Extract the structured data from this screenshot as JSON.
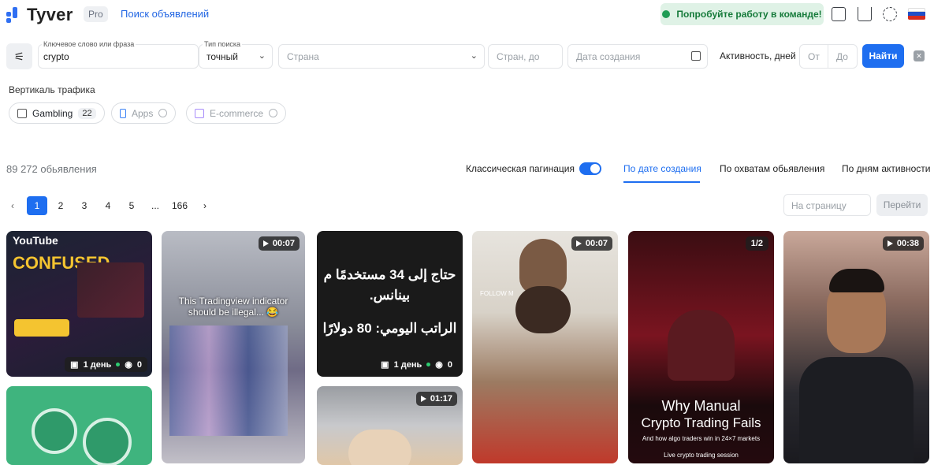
{
  "header": {
    "logo": "Tyver",
    "badge": "Pro",
    "nav_link": "Поиск объявлений",
    "team_button": "Попробуйте работу в команде!"
  },
  "filters": {
    "keyword_label": "Ключевое слово или фраза",
    "keyword_value": "crypto",
    "search_type_label": "Тип поиска",
    "search_type_value": "точный",
    "country_placeholder": "Страна",
    "countries_to_placeholder": "Стран, до",
    "date_placeholder": "Дата создания",
    "activity_label": "Активность, дней",
    "from_placeholder": "От",
    "to_placeholder": "До",
    "find_button": "Найти"
  },
  "vertical": {
    "title": "Вертикаль трафика",
    "chips": [
      {
        "label": "Gambling",
        "count": "22"
      },
      {
        "label": "Apps"
      },
      {
        "label": "E-commerce"
      }
    ]
  },
  "results": {
    "count": "89 272 обьявления",
    "pagination_label": "Классическая пагинация",
    "sort_options": [
      "По дате создания",
      "По охватам обьявления",
      "По дням активности"
    ]
  },
  "pagination": {
    "prev": "‹",
    "pages": [
      "1",
      "2",
      "3",
      "4",
      "5",
      "...",
      "166"
    ],
    "next": "›",
    "per_page_placeholder": "На страницу",
    "goto_button": "Перейти"
  },
  "cards": [
    {
      "text_top": "YouTube",
      "text_mid": "CONFUSED",
      "days": "1 день",
      "views": "0"
    },
    {
      "duration": "00:07",
      "caption": "This Tradingview indicator should be illegal... 😂"
    },
    {
      "text_ar1": "حتاج إلى 34 مستخدمًا م",
      "text_ar2": "بينانس.",
      "text_ar3": "الراتب اليومي: 80 دولارًا",
      "days": "1 день",
      "views": "0"
    },
    {
      "duration": "00:07",
      "watermark": "FOLLOW M"
    },
    {
      "badge": "1/2",
      "title1": "Why Manual",
      "title2": "Crypto Trading Fails",
      "subtitle": "And how algo traders win in 24×7 markets",
      "footer": "Live crypto trading session"
    },
    {
      "duration": "00:38"
    },
    {
      "duration": "01:17"
    }
  ],
  "colors": {
    "accent": "#1e6ef0",
    "team_bg": "#dff2e6",
    "team_text": "#157a3a"
  }
}
